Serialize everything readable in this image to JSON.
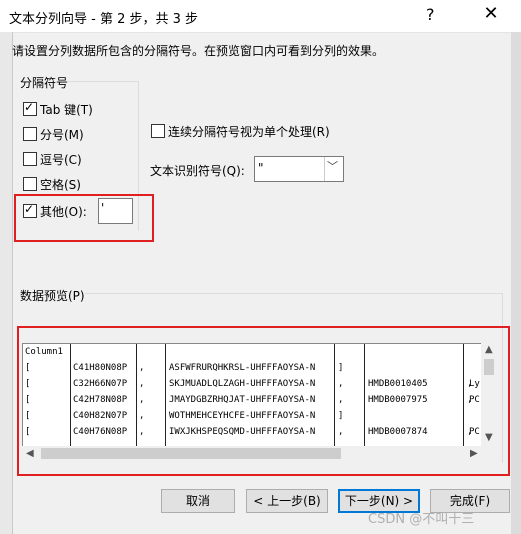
{
  "window": {
    "title": "文本分列向导 - 第 2 步，共 3 步",
    "help": "?",
    "close": "✕"
  },
  "description": "请设置分列数据所包含的分隔符号。在预览窗口内可看到分列的效果。",
  "delimiters": {
    "group_title": "分隔符号",
    "tab": {
      "label": "Tab 键(T)",
      "checked": true
    },
    "semicolon": {
      "label": "分号(M)",
      "checked": false
    },
    "comma": {
      "label": "逗号(C)",
      "checked": false
    },
    "space": {
      "label": "空格(S)",
      "checked": false
    },
    "other": {
      "label": "其他(O):",
      "checked": true,
      "value": "'"
    }
  },
  "consecutive": {
    "label": "连续分隔符号视为单个处理(R)",
    "checked": false
  },
  "text_qualifier": {
    "label": "文本识别符号(Q):",
    "value": "\""
  },
  "preview": {
    "label": "数据预览(P)",
    "rows": [
      [
        "Column1",
        "",
        "",
        "",
        "",
        "",
        "",
        ""
      ],
      [
        "[",
        "C41H80N08P",
        ",",
        "ASFWFRURQHKRSL-UHFFFAOYSA-N",
        "]",
        "",
        "",
        ""
      ],
      [
        "[",
        "C32H66N07P",
        ",",
        "SKJMUADLQLZAGH-UHFFFAOYSA-N",
        ",",
        "HMDB0010405",
        ",",
        "Ly"
      ],
      [
        "[",
        "C42H78N08P",
        ",",
        "JMAYDGBZRHQJAT-UHFFFAOYSA-N",
        ",",
        "HMDB0007975",
        ",",
        "PC"
      ],
      [
        "[",
        "C40H82N07P",
        ",",
        "WOTHMEHCEYHCFE-UHFFFAOYSA-N",
        "]",
        "",
        "",
        ""
      ],
      [
        "[",
        "C40H76N08P",
        ",",
        "IWXJKHSPEQSQMD-UHFFFAOYSA-N",
        ",",
        "HMDB0007874",
        ",",
        "PC"
      ]
    ]
  },
  "buttons": {
    "cancel": "取消",
    "back": "< 上一步(B)",
    "next": "下一步(N) >",
    "finish": "完成(F)"
  },
  "watermark": "CSDN @不叫十三",
  "colors": {
    "highlight": "#e02020",
    "default_button_border": "#0078d7"
  }
}
